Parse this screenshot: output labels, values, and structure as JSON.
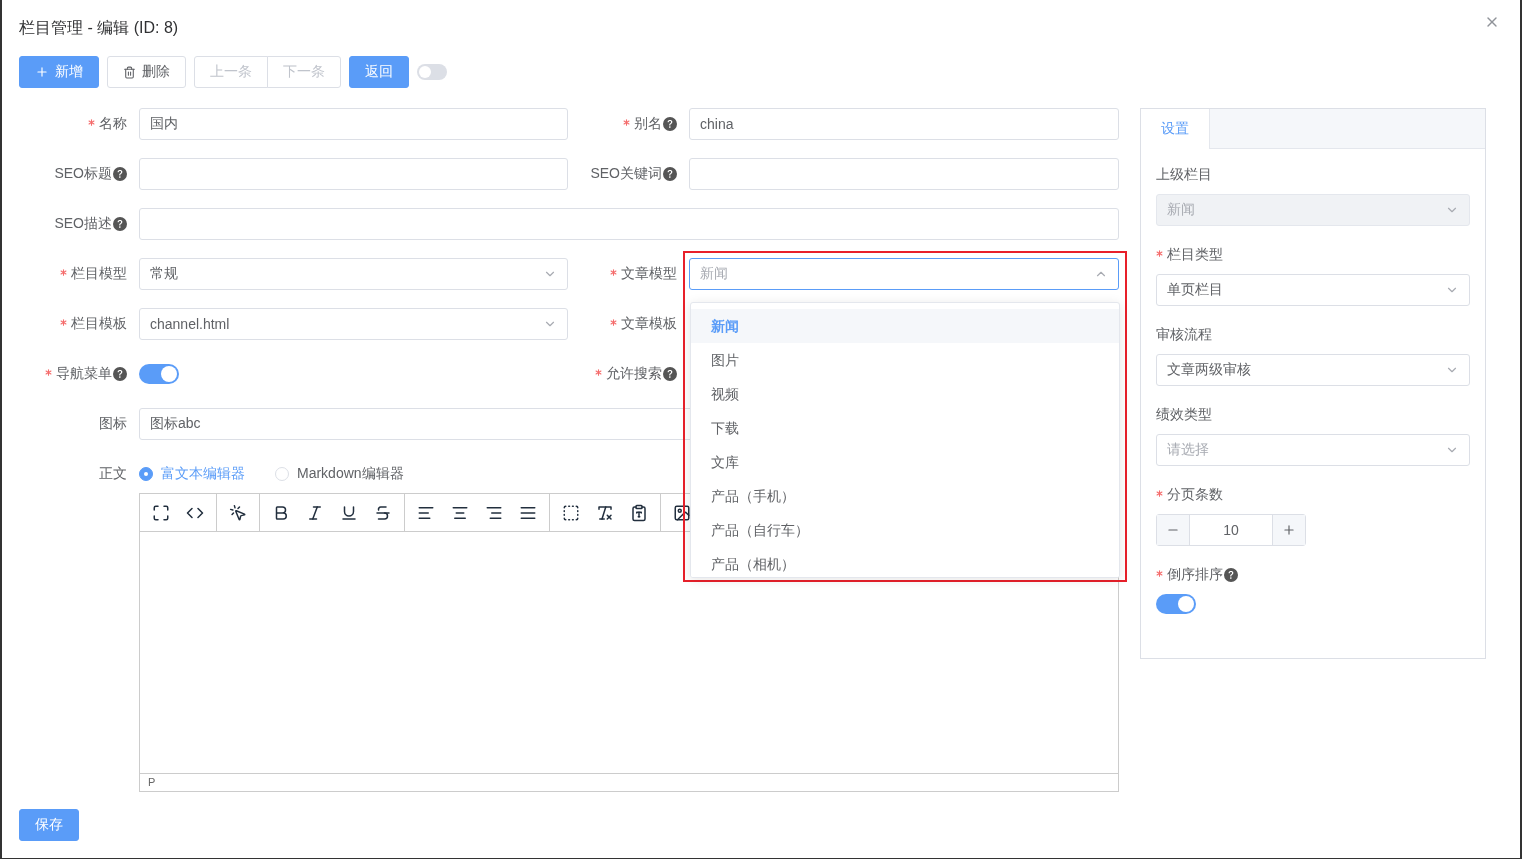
{
  "dialog": {
    "title": "栏目管理 - 编辑 (ID: 8)"
  },
  "toolbar": {
    "add": "新增",
    "delete": "删除",
    "prev": "上一条",
    "next": "下一条",
    "back": "返回",
    "switch_on": false,
    "prev_disabled": true,
    "next_disabled": true
  },
  "form": {
    "rows": [
      {
        "cells": [
          {
            "label": "名称",
            "required": true,
            "help": false,
            "kind": "input",
            "value": "国内"
          },
          {
            "label": "别名",
            "required": true,
            "help": true,
            "kind": "input",
            "value": "china"
          }
        ]
      },
      {
        "cells": [
          {
            "label": "SEO标题",
            "required": false,
            "help": true,
            "kind": "input"
          },
          {
            "label": "SEO关键词",
            "required": false,
            "help": true,
            "kind": "input"
          }
        ]
      },
      {
        "cells": [
          {
            "label": "SEO描述",
            "required": false,
            "help": true,
            "kind": "input",
            "wide": true
          }
        ]
      },
      {
        "cells": [
          {
            "label": "栏目模型",
            "required": true,
            "help": false,
            "kind": "select",
            "value": "常规"
          },
          {
            "label": "文章模型",
            "required": true,
            "help": false,
            "kind": "select",
            "placeholder": "新闻",
            "open": true
          }
        ]
      },
      {
        "cells": [
          {
            "label": "栏目模板",
            "required": true,
            "help": false,
            "kind": "select",
            "value": "channel.html"
          },
          {
            "label": "文章模板",
            "required": true,
            "help": false
          }
        ]
      },
      {
        "cells": [
          {
            "label": "导航菜单",
            "required": true,
            "help": true,
            "kind": "switch",
            "on": true
          },
          {
            "label": "允许搜索",
            "required": true,
            "help": true
          }
        ]
      },
      {
        "cells": [
          {
            "label": "图标",
            "required": false,
            "help": false,
            "kind": "input",
            "value": "图标abc",
            "wide": true
          }
        ]
      },
      {
        "cells": [
          {
            "label": "正文",
            "required": false,
            "help": false,
            "kind": "editor",
            "options": [
              {
                "label": "富文本编辑器",
                "selected": true
              },
              {
                "label": "Markdown编辑器",
                "selected": false
              }
            ],
            "status": "P"
          }
        ]
      }
    ]
  },
  "dropdown": {
    "items": [
      {
        "label": "新闻",
        "selected": true
      },
      {
        "label": "图片",
        "selected": false
      },
      {
        "label": "视频",
        "selected": false
      },
      {
        "label": "下载",
        "selected": false
      },
      {
        "label": "文库",
        "selected": false
      },
      {
        "label": "产品（手机）",
        "selected": false
      },
      {
        "label": "产品（自行车）",
        "selected": false
      },
      {
        "label": "产品（相机）",
        "selected": false
      }
    ]
  },
  "save": "保存",
  "side": {
    "tabs": [
      {
        "label": "设置",
        "selected": true
      }
    ],
    "fields": [
      {
        "label": "上级栏目",
        "required": false,
        "help": false,
        "kind": "select",
        "value": "新闻",
        "disabled": true
      },
      {
        "label": "栏目类型",
        "required": true,
        "help": false,
        "kind": "select",
        "value": "单页栏目",
        "disabled": false
      },
      {
        "label": "审核流程",
        "required": false,
        "help": false,
        "kind": "select",
        "value": "文章两级审核",
        "disabled": false
      },
      {
        "label": "绩效类型",
        "required": false,
        "help": false,
        "kind": "select",
        "placeholder": "请选择",
        "disabled": false
      },
      {
        "label": "分页条数",
        "required": true,
        "help": false,
        "kind": "number",
        "value": "10"
      },
      {
        "label": "倒序排序",
        "required": true,
        "help": true,
        "kind": "switch",
        "on": true
      }
    ]
  }
}
